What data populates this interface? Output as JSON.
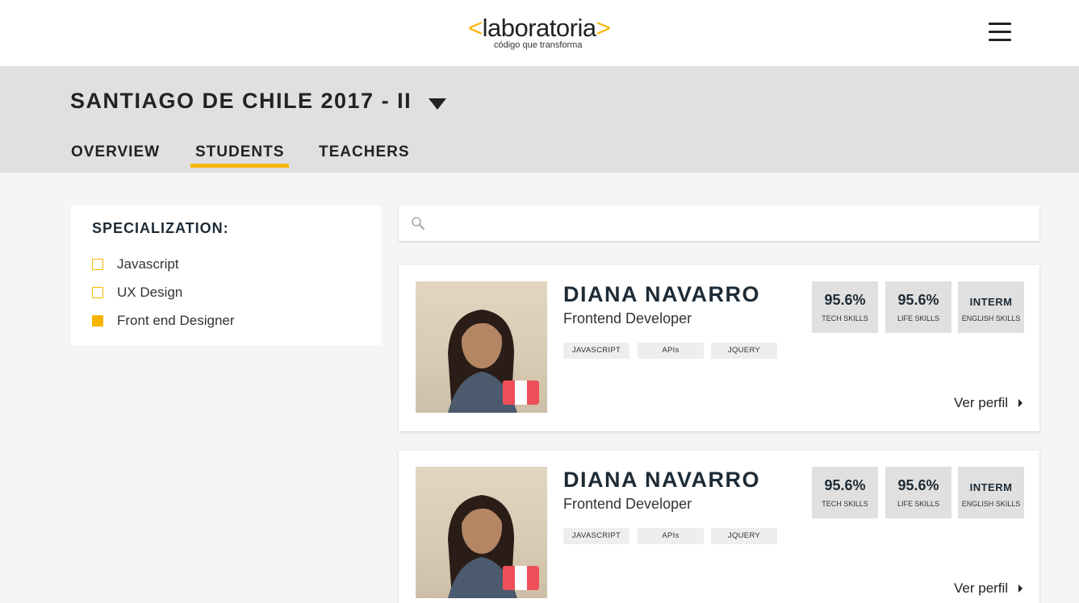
{
  "header": {
    "logo": {
      "open": "<",
      "word": "laboratoria",
      "close": ">",
      "tagline": "código que transforma"
    },
    "menu_icon": "hamburger-menu-icon"
  },
  "cohort": {
    "title": "SANTIAGO DE CHILE 2017 - II",
    "dropdown_icon": "caret-down-icon"
  },
  "tabs": [
    {
      "label": "OVERVIEW",
      "active": false
    },
    {
      "label": "STUDENTS",
      "active": true
    },
    {
      "label": "TEACHERS",
      "active": false
    }
  ],
  "filter": {
    "title": "SPECIALIZATION:",
    "options": [
      {
        "label": "Javascript",
        "checked": false
      },
      {
        "label": "UX Design",
        "checked": false
      },
      {
        "label": "Front end Designer",
        "checked": true
      }
    ]
  },
  "search": {
    "placeholder": "",
    "value": "",
    "icon": "search-icon"
  },
  "students": [
    {
      "name": "DIANA NAVARRO",
      "role": "Frontend Developer",
      "country_flag": "peru-flag-icon",
      "tags": [
        "JAVASCRIPT",
        "APIs",
        "JQUERY"
      ],
      "stats": [
        {
          "value": "95.6%",
          "label": "TECH SKILLS"
        },
        {
          "value": "95.6%",
          "label": "LIFE SKILLS"
        },
        {
          "value": "INTERM",
          "label": "ENGLISH SKILLS"
        }
      ],
      "link": "Ver perfil"
    },
    {
      "name": "DIANA NAVARRO",
      "role": "Frontend Developer",
      "country_flag": "peru-flag-icon",
      "tags": [
        "JAVASCRIPT",
        "APIs",
        "JQUERY"
      ],
      "stats": [
        {
          "value": "95.6%",
          "label": "TECH SKILLS"
        },
        {
          "value": "95.6%",
          "label": "LIFE SKILLS"
        },
        {
          "value": "INTERM",
          "label": "ENGLISH SKILLS"
        }
      ],
      "link": "Ver perfil"
    }
  ],
  "colors": {
    "accent": "#f7b500",
    "band": "#e0e0e0",
    "flag_red": "#ef4f58",
    "dark": "#1d2b36"
  }
}
